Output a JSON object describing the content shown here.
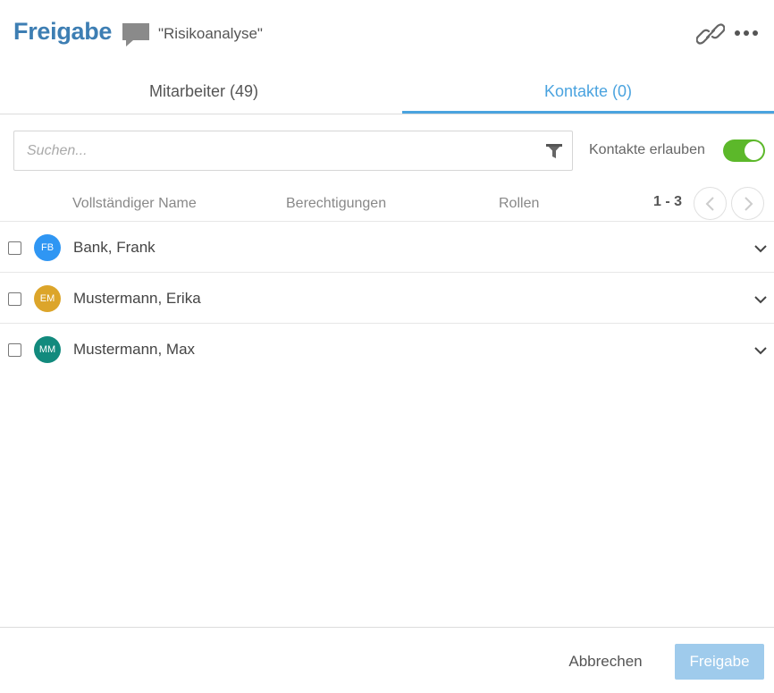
{
  "header": {
    "title": "Freigabe",
    "document_name": "\"Risikoanalyse\""
  },
  "tabs": [
    {
      "label": "Mitarbeiter (49)",
      "active": false
    },
    {
      "label": "Kontakte (0)",
      "active": true
    }
  ],
  "search": {
    "placeholder": "Suchen...",
    "value": ""
  },
  "allow_contacts": {
    "label": "Kontakte erlauben",
    "enabled": true
  },
  "columns": [
    "Vollständiger Name",
    "Berechtigungen",
    "Rollen"
  ],
  "pager": {
    "range": "1 - 3"
  },
  "rows": [
    {
      "initials": "FB",
      "name": "Bank, Frank",
      "avatar_color": "#2f96f3"
    },
    {
      "initials": "EM",
      "name": "Mustermann, Erika",
      "avatar_color": "#dca52a"
    },
    {
      "initials": "MM",
      "name": "Mustermann, Max",
      "avatar_color": "#128a7d"
    }
  ],
  "footer": {
    "cancel_label": "Abbrechen",
    "share_label": "Freigabe"
  },
  "colors": {
    "accent": "#3d7eb3",
    "tab_active": "#4aa3df",
    "toggle_on": "#5cb82a",
    "primary_button_disabled": "#9fcbec"
  },
  "icons": [
    "comment-icon",
    "link-icon",
    "more-icon",
    "filter-icon",
    "chevron-left-icon",
    "chevron-right-icon",
    "chevron-down-icon"
  ]
}
